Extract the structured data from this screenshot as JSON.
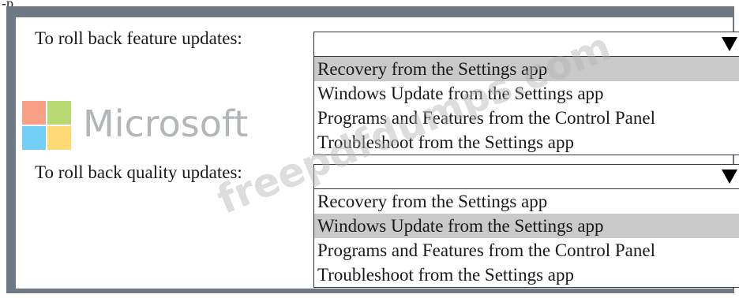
{
  "top_label": "-p",
  "questions": [
    {
      "label": "To roll back feature updates:",
      "options": [
        "Recovery from the Settings app",
        "Windows Update from the Settings app",
        "Programs and Features from the Control Panel",
        "Troubleshoot from the Settings app"
      ],
      "selected_index": 0
    },
    {
      "label": "To roll back quality updates:",
      "options": [
        "Recovery from the Settings app",
        "Windows Update from the Settings app",
        "Programs and Features from the Control Panel",
        "Troubleshoot from the Settings app"
      ],
      "selected_index": 1
    }
  ],
  "watermark": {
    "logo_text": "Microsoft",
    "site_text": "freepdfdumps.com"
  },
  "colors": {
    "frame": "#6f7885",
    "selected_option": "#c9c9c9",
    "logo_red": "#f25022",
    "logo_green": "#7fba00",
    "logo_blue": "#00a4ef",
    "logo_yellow": "#ffb900"
  }
}
